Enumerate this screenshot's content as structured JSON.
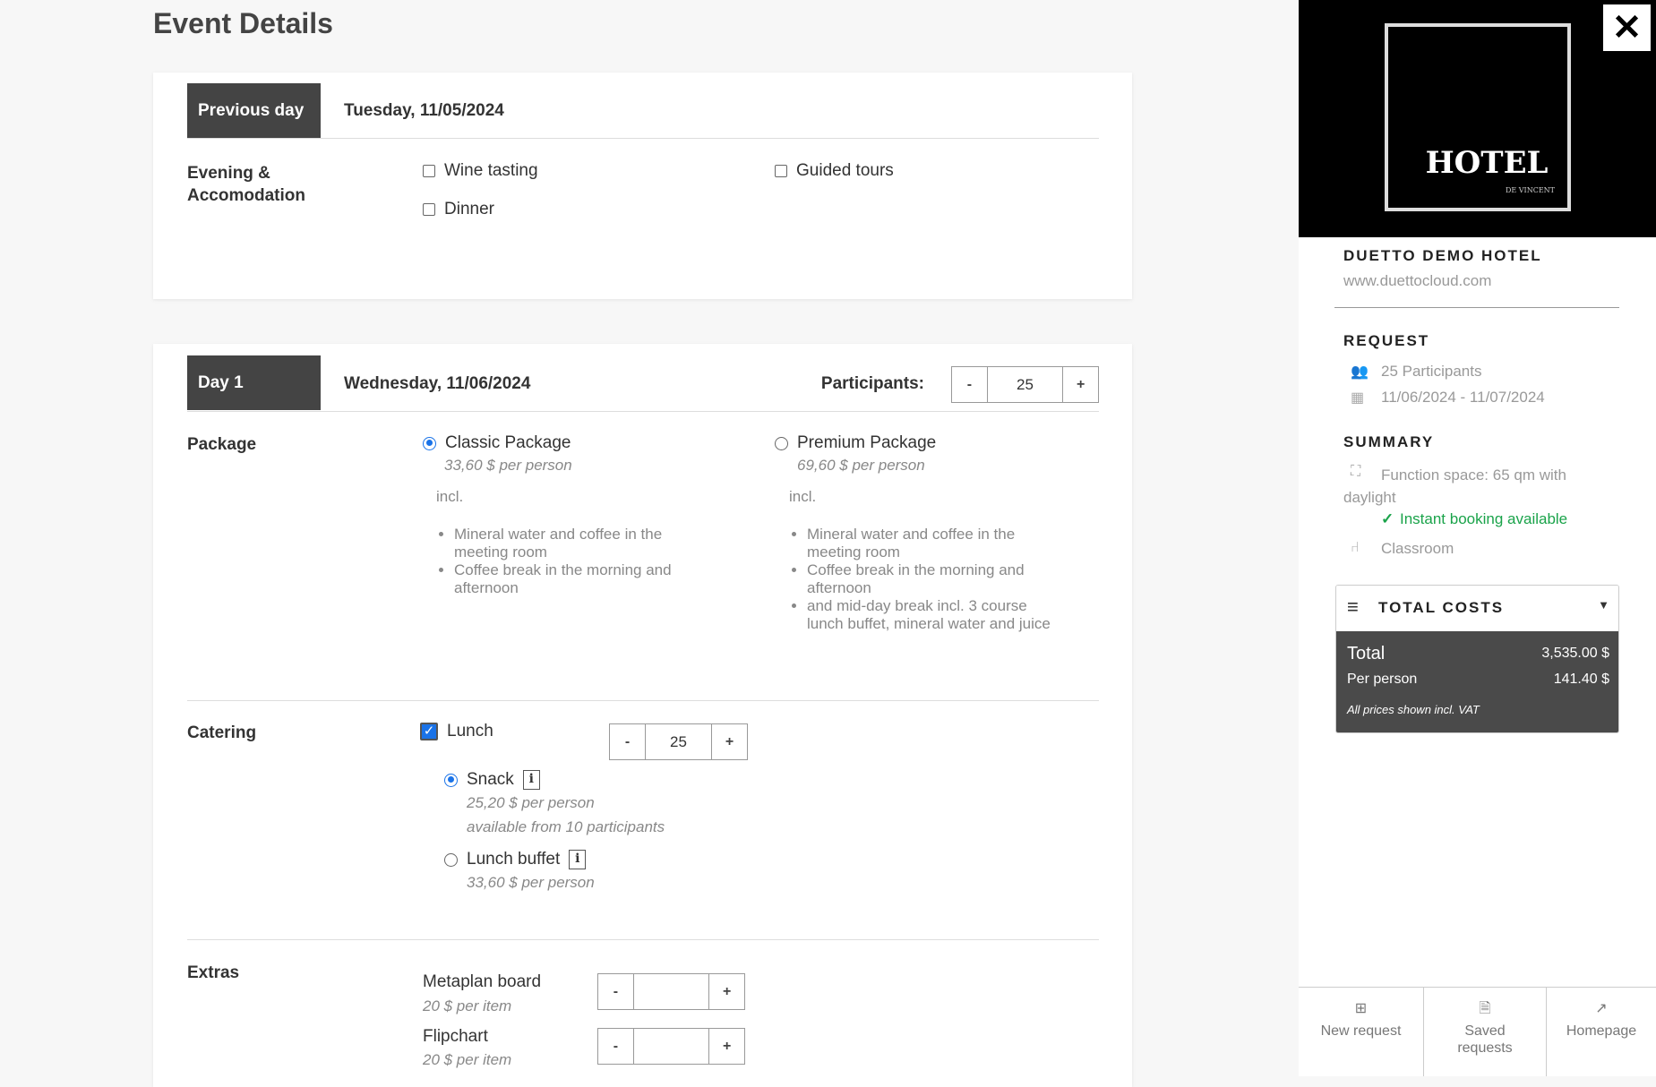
{
  "page_title": "Event Details",
  "previous_day": {
    "label": "Previous day",
    "date": "Tuesday, 11/05/2024",
    "section_label": "Evening & Accomodation",
    "options": [
      "Wine tasting",
      "Guided tours",
      "Dinner"
    ]
  },
  "day1": {
    "label": "Day 1",
    "date": "Wednesday, 11/06/2024",
    "participants_label": "Participants:",
    "participants": "25",
    "package": {
      "label": "Package",
      "options": [
        {
          "name": "Classic Package",
          "price": "33,60 $ per person",
          "incl": "incl.",
          "items": [
            "Mineral water and coffee in the meeting room",
            "Coffee break in the morning and afternoon"
          ],
          "selected": true
        },
        {
          "name": "Premium Package",
          "price": "69,60 $ per person",
          "incl": "incl.",
          "items": [
            "Mineral water and coffee in the meeting room",
            "Coffee break in the morning and afternoon",
            "and mid-day break incl. 3 course lunch buffet, mineral water and juice"
          ],
          "selected": false
        }
      ]
    },
    "catering": {
      "label": "Catering",
      "lunch_label": "Lunch",
      "lunch_qty": "25",
      "snack": {
        "name": "Snack",
        "price": "25,20 $ per person",
        "note": "available from 10 participants"
      },
      "buffet": {
        "name": "Lunch buffet",
        "price": "33,60 $ per person"
      }
    },
    "extras": {
      "label": "Extras",
      "items": [
        {
          "name": "Metaplan board",
          "price": "20 $ per item"
        },
        {
          "name": "Flipchart",
          "price": "20 $ per item"
        }
      ]
    }
  },
  "stepper": {
    "minus": "-",
    "plus": "+"
  },
  "info_icon": "i",
  "sidebar": {
    "logo_text": "HOTEL",
    "logo_sub": "DE VINCENT",
    "hotel_name": "DUETTO DEMO HOTEL",
    "url": "www.duettocloud.com",
    "request_title": "REQUEST",
    "participants": "25 Participants",
    "dates": "11/06/2024 - 11/07/2024",
    "summary_title": "SUMMARY",
    "function_space": "Function space: 65 qm with daylight",
    "instant": "Instant booking available",
    "setup": "Classroom",
    "costs_title": "TOTAL COSTS",
    "total_label": "Total",
    "total": "3,535.00 $",
    "pp_label": "Per person",
    "pp": "141.40 $",
    "vat": "All prices shown incl. VAT",
    "nav": [
      {
        "label": "New request"
      },
      {
        "label": "Saved requests"
      },
      {
        "label": "Homepage"
      }
    ]
  },
  "colors": {
    "accent": "#1a73e8",
    "success": "#1aa34a",
    "dark": "#444444"
  }
}
